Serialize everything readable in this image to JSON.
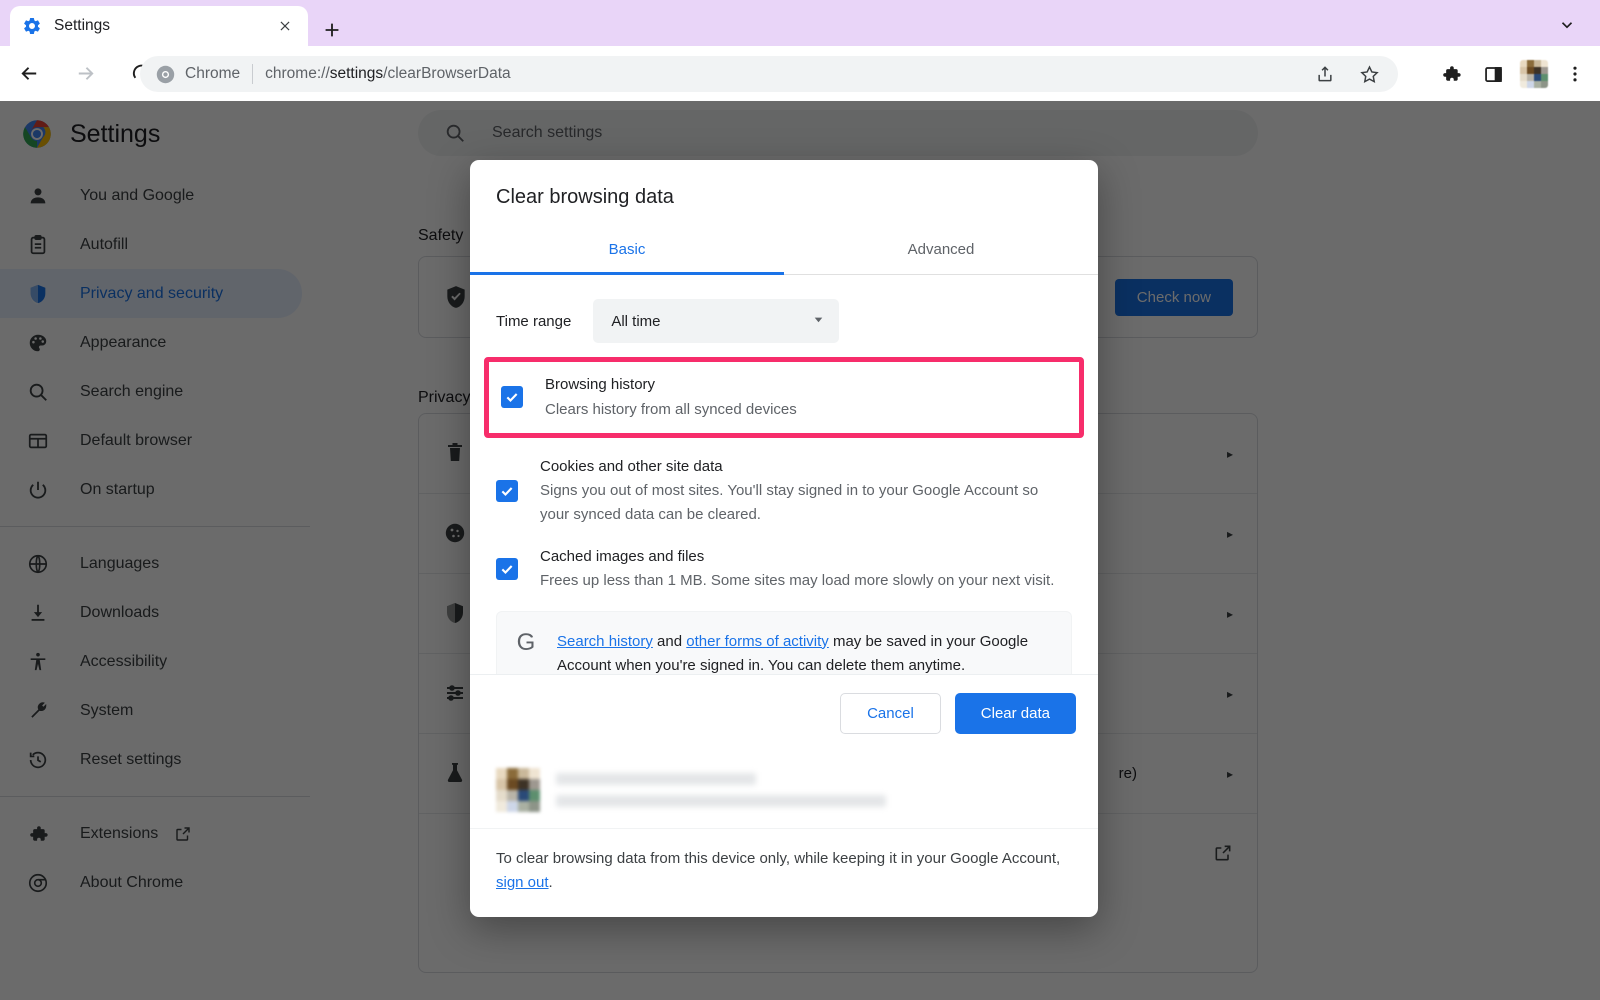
{
  "browser": {
    "tab": {
      "title": "Settings",
      "favicon_icon": "gear-icon",
      "close_icon": "close-icon"
    },
    "new_tab_label": "+",
    "tabstrip_chevron_icon": "chevron-down-icon",
    "nav": {
      "back_icon": "arrow-left-icon",
      "forward_icon": "arrow-right-icon",
      "reload_icon": "reload-icon"
    },
    "omnibox": {
      "chrome_logo_icon": "chrome-logo-icon",
      "scheme_chip": "Chrome",
      "url_prefix": "chrome://",
      "url_bold": "settings",
      "url_suffix": "/clearBrowserData",
      "share_icon": "share-icon",
      "bookmark_icon": "star-icon"
    },
    "toolbar_right": {
      "extensions_icon": "puzzle-icon",
      "side_panel_icon": "side-panel-icon",
      "profile_icon": "avatar-icon",
      "menu_icon": "three-dot-menu-icon"
    }
  },
  "sidebar": {
    "title": "Settings",
    "logo_icon": "chrome-logo-icon",
    "items": [
      {
        "label": "You and Google",
        "icon": "person-icon",
        "active": false
      },
      {
        "label": "Autofill",
        "icon": "clipboard-icon",
        "active": false
      },
      {
        "label": "Privacy and security",
        "icon": "shield-icon",
        "active": true
      },
      {
        "label": "Appearance",
        "icon": "palette-icon",
        "active": false
      },
      {
        "label": "Search engine",
        "icon": "search-icon",
        "active": false
      },
      {
        "label": "Default browser",
        "icon": "browser-window-icon",
        "active": false
      },
      {
        "label": "On startup",
        "icon": "power-icon",
        "active": false
      }
    ],
    "items2": [
      {
        "label": "Languages",
        "icon": "globe-icon"
      },
      {
        "label": "Downloads",
        "icon": "download-icon"
      },
      {
        "label": "Accessibility",
        "icon": "accessibility-icon"
      },
      {
        "label": "System",
        "icon": "wrench-icon"
      },
      {
        "label": "Reset settings",
        "icon": "history-restore-icon"
      }
    ],
    "items3": [
      {
        "label": "Extensions",
        "icon": "puzzle-icon",
        "external": true
      },
      {
        "label": "About Chrome",
        "icon": "chrome-logo-icon",
        "external": false
      }
    ]
  },
  "settings_page": {
    "search": {
      "placeholder": "Search settings",
      "icon": "search-icon"
    },
    "safety_heading": "Safety",
    "safety_check_button": "Check now",
    "safety_icon": "shield-check-icon",
    "privacy_heading": "Privacy",
    "privacy_rows": [
      {
        "icon": "trash-icon",
        "arrow": "▸"
      },
      {
        "icon": "cookie-icon",
        "arrow": "▸"
      },
      {
        "icon": "shield-icon",
        "arrow": "▸"
      },
      {
        "icon": "sliders-icon",
        "arrow": "▸"
      },
      {
        "icon": "flask-icon",
        "arrow": "▸",
        "trailing_text": "re)"
      },
      {
        "icon": "external-link-icon",
        "arrow": ""
      }
    ]
  },
  "dialog": {
    "title": "Clear browsing data",
    "tabs": [
      {
        "label": "Basic",
        "active": true
      },
      {
        "label": "Advanced",
        "active": false
      }
    ],
    "time_range": {
      "label": "Time range",
      "value": "All time",
      "caret_icon": "chevron-down-icon"
    },
    "options": [
      {
        "title": "Browsing history",
        "subtitle": "Clears history from all synced devices",
        "checked": true,
        "highlighted": true
      },
      {
        "title": "Cookies and other site data",
        "subtitle": "Signs you out of most sites. You'll stay signed in to your Google Account so your synced data can be cleared.",
        "checked": true,
        "highlighted": false
      },
      {
        "title": "Cached images and files",
        "subtitle": "Frees up less than 1 MB. Some sites may load more slowly on your next visit.",
        "checked": true,
        "highlighted": false
      }
    ],
    "google_info": {
      "logo_icon": "google-g-icon",
      "link1": "Search history",
      "mid": " and ",
      "link2": "other forms of activity",
      "rest": " may be saved in your Google Account when you're signed in. You can delete them anytime."
    },
    "buttons": {
      "cancel": "Cancel",
      "clear": "Clear data"
    },
    "footer": {
      "text_before": "To clear browsing data from this device only, while keeping it in your Google Account, ",
      "link": "sign out",
      "text_after": "."
    }
  },
  "colors": {
    "accent_blue": "#1a73e8",
    "highlight_pink": "#F72D6B",
    "tabstrip_lavender": "#E9D5F8",
    "dim_overlay": "rgba(0,0,0,0.58)"
  }
}
